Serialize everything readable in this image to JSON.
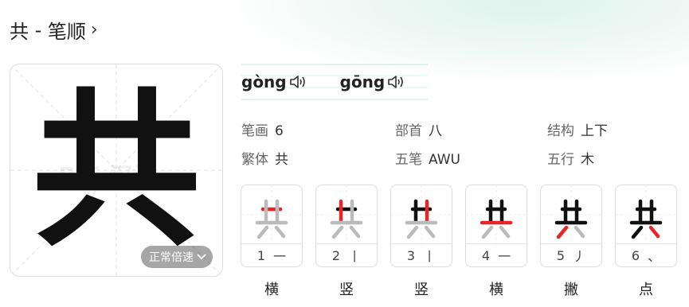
{
  "title": {
    "char": "共",
    "sep": " - ",
    "text": "笔顺"
  },
  "character": "共",
  "speed_button": {
    "label": "正常倍速"
  },
  "pinyin": [
    {
      "text": "gòng"
    },
    {
      "text": "gōng"
    }
  ],
  "info": {
    "strokes_label": "笔画",
    "strokes_value": "6",
    "radical_label": "部首",
    "radical_value": "八",
    "structure_label": "结构",
    "structure_value": "上下",
    "traditional_label": "繁体",
    "traditional_value": "共",
    "wubi_label": "五笔",
    "wubi_value": "AWU",
    "wuxing_label": "五行",
    "wuxing_value": "木"
  },
  "strokes": [
    {
      "num": "1",
      "sym": "一",
      "name": "横"
    },
    {
      "num": "2",
      "sym": "丨",
      "name": "竖"
    },
    {
      "num": "3",
      "sym": "丨",
      "name": "竖"
    },
    {
      "num": "4",
      "sym": "一",
      "name": "横"
    },
    {
      "num": "5",
      "sym": "丿",
      "name": "撇"
    },
    {
      "num": "6",
      "sym": "、",
      "name": "点"
    }
  ],
  "colors": {
    "highlight": "#e8262a",
    "done": "#111111",
    "pending": "#bbbbbb",
    "accent_line": "#bfe8dc"
  }
}
